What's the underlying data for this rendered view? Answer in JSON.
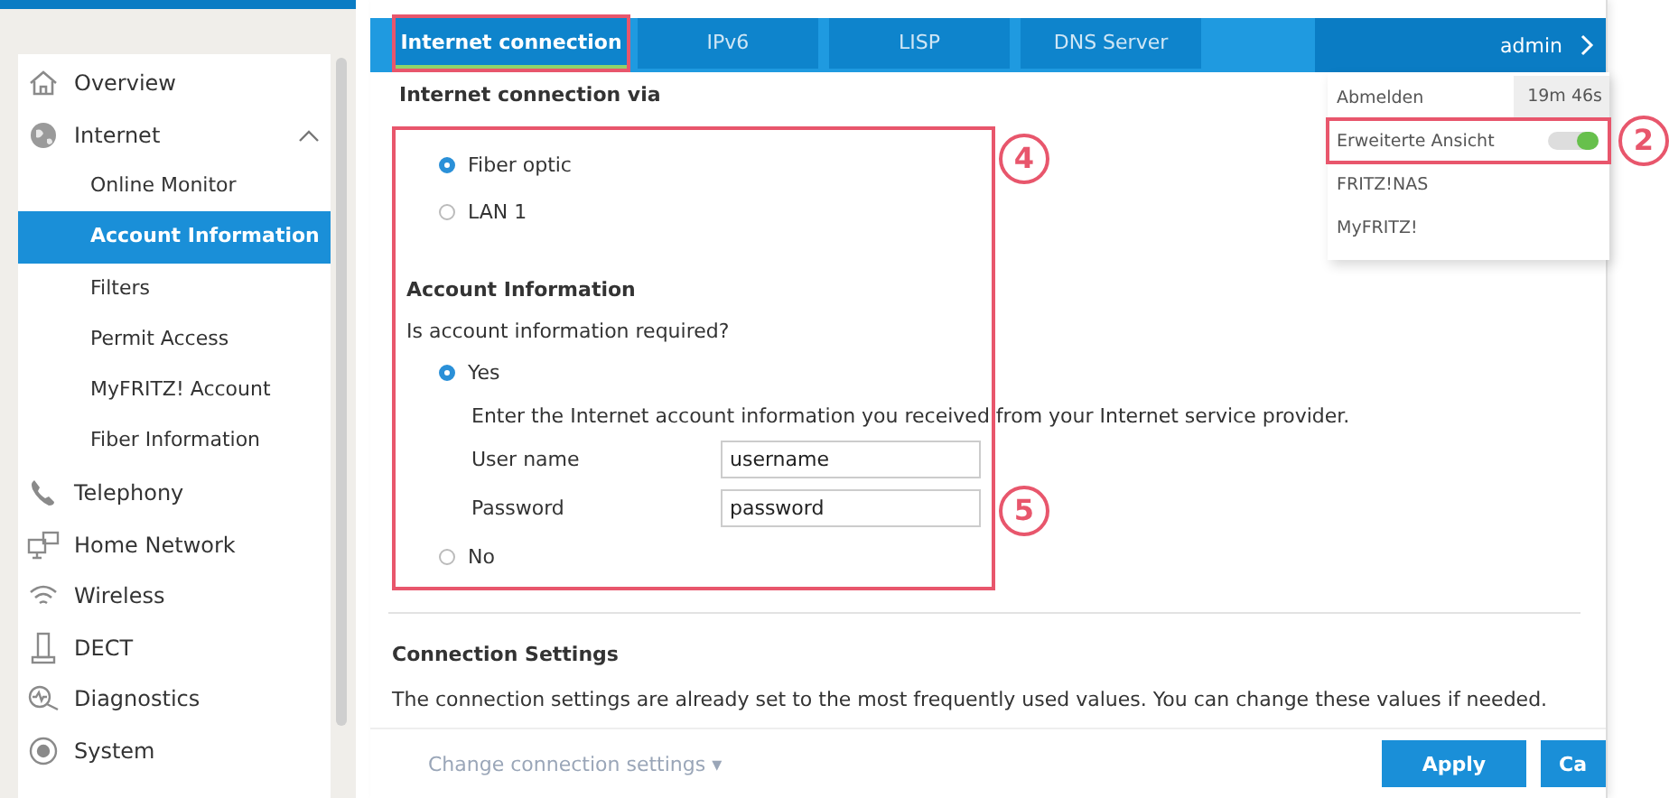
{
  "sidebar": {
    "items": [
      {
        "label": "Overview",
        "selected": false
      },
      {
        "label": "Internet",
        "selected": false,
        "expanded": true,
        "children": [
          {
            "label": "Online Monitor",
            "selected": false
          },
          {
            "label": "Account Information",
            "selected": true
          },
          {
            "label": "Filters",
            "selected": false
          },
          {
            "label": "Permit Access",
            "selected": false
          },
          {
            "label": "MyFRITZ! Account",
            "selected": false
          },
          {
            "label": "Fiber Information",
            "selected": false
          }
        ]
      },
      {
        "label": "Telephony",
        "selected": false
      },
      {
        "label": "Home Network",
        "selected": false
      },
      {
        "label": "Wireless",
        "selected": false
      },
      {
        "label": "DECT",
        "selected": false
      },
      {
        "label": "Diagnostics",
        "selected": false
      },
      {
        "label": "System",
        "selected": false
      }
    ]
  },
  "tabs": [
    {
      "label": "Internet connection",
      "selected": true,
      "highlighted": true
    },
    {
      "label": "IPv6",
      "selected": false,
      "highlighted": false
    },
    {
      "label": "LISP",
      "selected": false,
      "highlighted": false
    },
    {
      "label": "DNS Server",
      "selected": false,
      "highlighted": false
    }
  ],
  "user_menu": {
    "user": "admin",
    "items": [
      {
        "kind": "timer",
        "label": "Abmelden",
        "value": "19m 46s",
        "highlighted": false
      },
      {
        "kind": "toggle",
        "label": "Erweiterte Ansicht",
        "on": true,
        "highlighted": true
      },
      {
        "kind": "link",
        "label": "FRITZ!NAS",
        "highlighted": false
      },
      {
        "kind": "link",
        "label": "MyFRITZ!",
        "highlighted": false
      }
    ]
  },
  "form": {
    "highlighted": true,
    "connection_via": {
      "title": "Internet connection via",
      "options": [
        {
          "label": "Fiber optic",
          "selected": true
        },
        {
          "label": "LAN 1",
          "selected": false
        }
      ]
    },
    "account": {
      "title": "Account Information",
      "question": "Is account information required?",
      "yes": {
        "label": "Yes",
        "selected": true
      },
      "hint": "Enter the Internet account information you received from your Internet service provider.",
      "fields": [
        {
          "label": "User name",
          "value": "username"
        },
        {
          "label": "Password",
          "value": "password"
        }
      ],
      "no": {
        "label": "No",
        "selected": false
      }
    }
  },
  "connection_settings": {
    "title": "Connection Settings",
    "text": "The connection settings are already set to the most frequently used values. You can change these values if needed.",
    "link": "Change connection settings ▾"
  },
  "buttons": [
    {
      "label": "Apply"
    },
    {
      "label": "Ca"
    }
  ],
  "callouts": [
    {
      "label": "4"
    },
    {
      "label": "5"
    },
    {
      "label": "2"
    }
  ]
}
